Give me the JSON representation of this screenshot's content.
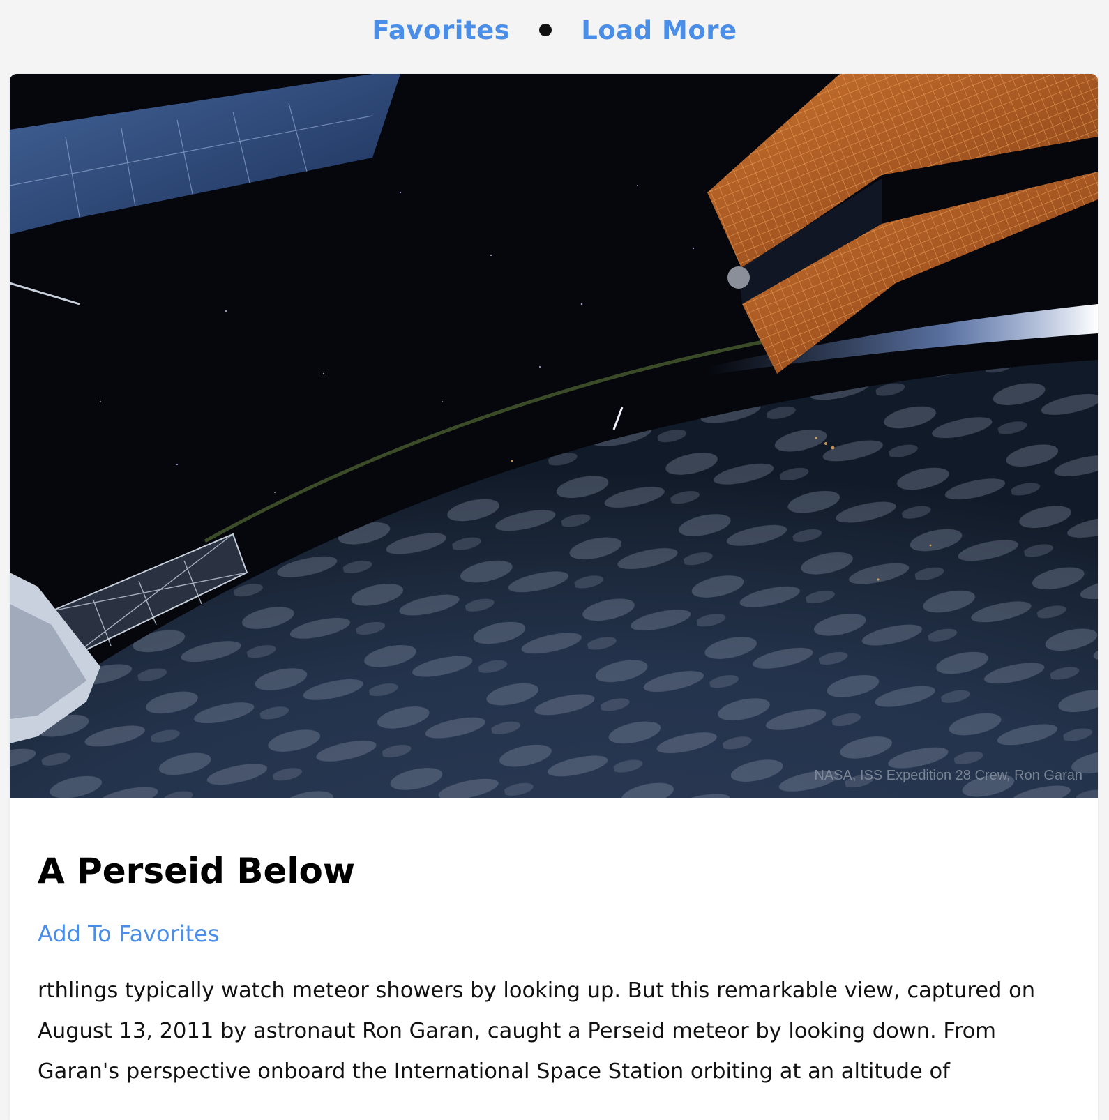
{
  "nav": {
    "favorites_label": "Favorites",
    "load_more_label": "Load More",
    "link_color": "#4a8ee8"
  },
  "post": {
    "title": "A Perseid Below",
    "add_favorites_label": "Add To Favorites",
    "image_credit": "NASA, ISS Expedition 28 Crew, Ron Garan",
    "image_alt_subject": "ISS view of Earth's night horizon with a Perseid meteor streak",
    "description": "rthlings typically watch meteor showers by looking up. But this remarkable view, captured on August 13, 2011 by astronaut Ron Garan, caught a Perseid meteor by looking down. From Garan's perspective onboard the International Space Station orbiting at an altitude of"
  },
  "icons": {
    "separator": "bullet-dot-icon"
  }
}
